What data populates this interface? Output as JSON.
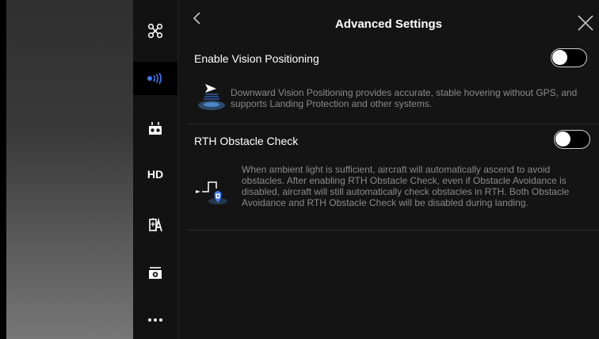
{
  "header": {
    "title": "Advanced Settings"
  },
  "sidebar": {
    "items": [
      {
        "icon": "aircraft-icon"
      },
      {
        "icon": "signal-icon",
        "active": true
      },
      {
        "icon": "remote-controller-icon"
      },
      {
        "icon": "hd-icon",
        "label": "HD"
      },
      {
        "icon": "battery-icon"
      },
      {
        "icon": "camera-icon"
      },
      {
        "icon": "more-icon"
      }
    ]
  },
  "settings": [
    {
      "label": "Enable Vision Positioning",
      "enabled": false,
      "description": "Downward Vision Positioning provides accurate, stable hovering without GPS, and supports Landing Protection and other systems."
    },
    {
      "label": "RTH Obstacle Check",
      "enabled": false,
      "description": "When ambient light is sufficient, aircraft will automatically ascend to avoid obstacles. After enabling RTH Obstacle Check, even if Obstacle Avoidance is disabled, aircraft will still automatically check obstacles in RTH. Both Obstacle Avoidance and RTH Obstacle Check will be disabled during landing."
    }
  ],
  "colors": {
    "panel_bg": "#141414",
    "sidebar_bg": "#121212",
    "accent": "#3d7bf5",
    "desc_text": "#8a8a8a"
  }
}
